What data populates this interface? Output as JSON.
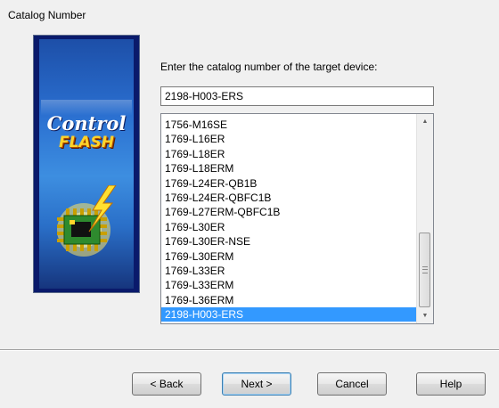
{
  "window": {
    "title": "Catalog Number"
  },
  "banner": {
    "line1": "Control",
    "line2": "FLASH"
  },
  "form": {
    "prompt": "Enter the catalog number of the target device:",
    "input_value": "2198-H003-ERS"
  },
  "list": {
    "items": [
      "1756-M16SE",
      "1769-L16ER",
      "1769-L18ER",
      "1769-L18ERM",
      "1769-L24ER-QB1B",
      "1769-L24ER-QBFC1B",
      "1769-L27ERM-QBFC1B",
      "1769-L30ER",
      "1769-L30ER-NSE",
      "1769-L30ERM",
      "1769-L33ER",
      "1769-L33ERM",
      "1769-L36ERM",
      "2198-H003-ERS"
    ],
    "selected": "2198-H003-ERS"
  },
  "buttons": {
    "back": "< Back",
    "next": "Next >",
    "cancel": "Cancel",
    "help": "Help"
  },
  "colors": {
    "selection": "#3399ff",
    "banner_bg": "#0a1a6b",
    "flash_text": "#ffd32a"
  }
}
